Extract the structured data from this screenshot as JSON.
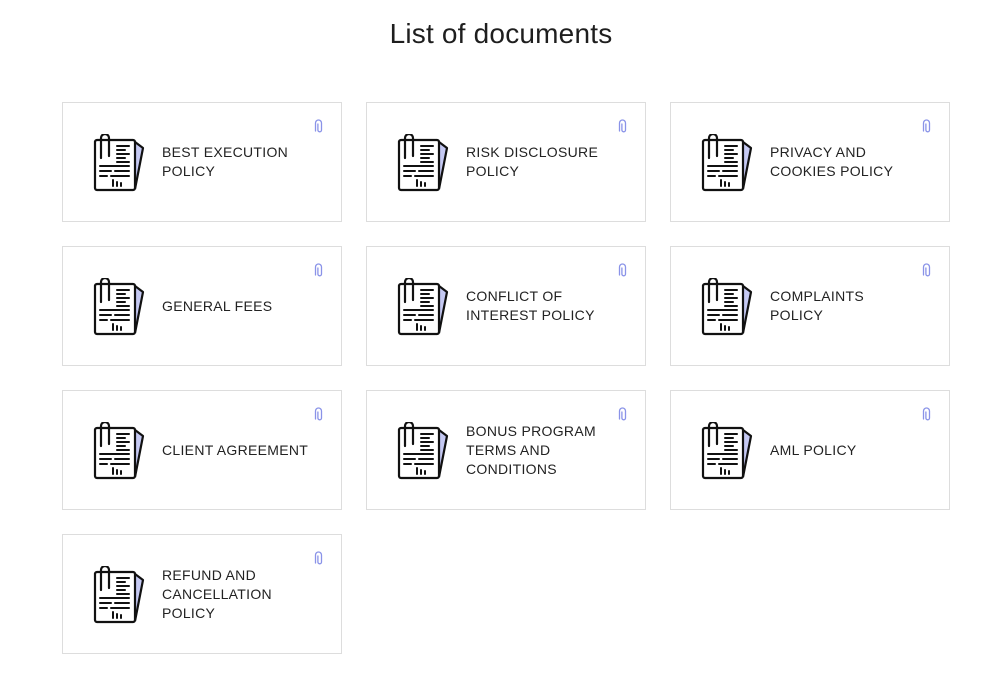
{
  "page": {
    "title": "List of documents"
  },
  "colors": {
    "accent": "#8a93e8",
    "icon_stroke": "#111111",
    "card_border": "#dddddd"
  },
  "documents": [
    {
      "label": "BEST EXECUTION POLICY",
      "icon": "document-icon",
      "attachment_icon": "paperclip-icon"
    },
    {
      "label": "RISK DISCLOSURE POLICY",
      "icon": "document-icon",
      "attachment_icon": "paperclip-icon"
    },
    {
      "label": "PRIVACY AND COOKIES POLICY",
      "icon": "document-icon",
      "attachment_icon": "paperclip-icon"
    },
    {
      "label": "GENERAL FEES",
      "icon": "document-icon",
      "attachment_icon": "paperclip-icon"
    },
    {
      "label": "CONFLICT OF INTEREST POLICY",
      "icon": "document-icon",
      "attachment_icon": "paperclip-icon"
    },
    {
      "label": "COMPLAINTS POLICY",
      "icon": "document-icon",
      "attachment_icon": "paperclip-icon"
    },
    {
      "label": "CLIENT AGREEMENT",
      "icon": "document-icon",
      "attachment_icon": "paperclip-icon"
    },
    {
      "label": "BONUS PROGRAM TERMS AND CONDITIONS",
      "icon": "document-icon",
      "attachment_icon": "paperclip-icon"
    },
    {
      "label": "AML POLICY",
      "icon": "document-icon",
      "attachment_icon": "paperclip-icon"
    },
    {
      "label": "REFUND AND CANCELLATION POLICY",
      "icon": "document-icon",
      "attachment_icon": "paperclip-icon"
    }
  ]
}
